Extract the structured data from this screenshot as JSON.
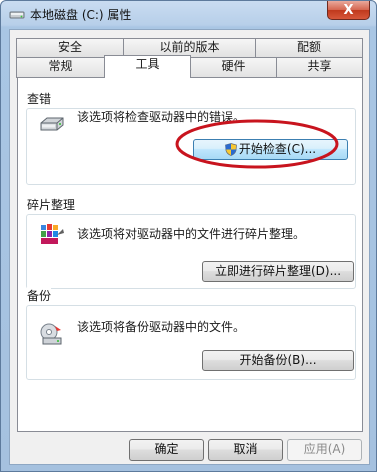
{
  "window": {
    "title": "本地磁盘 (C:) 属性",
    "close_symbol": "X"
  },
  "tabs_top": [
    {
      "label": "安全"
    },
    {
      "label": "以前的版本"
    },
    {
      "label": "配额"
    }
  ],
  "tabs_bottom": [
    {
      "label": "常规"
    },
    {
      "label": "工具",
      "active": true
    },
    {
      "label": "硬件"
    },
    {
      "label": "共享"
    }
  ],
  "sections": {
    "check": {
      "title": "查错",
      "description": "该选项将检查驱动器中的错误。",
      "button": "开始检查(C)...",
      "icon": "drive-icon"
    },
    "defrag": {
      "title": "碎片整理",
      "description": "该选项将对驱动器中的文件进行碎片整理。",
      "button": "立即进行碎片整理(D)...",
      "icon": "defrag-icon"
    },
    "backup": {
      "title": "备份",
      "description": "该选项将备份驱动器中的文件。",
      "button": "开始备份(B)...",
      "icon": "backup-icon"
    }
  },
  "footer": {
    "ok": "确定",
    "cancel": "取消",
    "apply": "应用(A)"
  },
  "colors": {
    "annotation_red": "#c8141e",
    "focus_blue": "#3c7fb1",
    "titlebar": "#b7cfe9"
  }
}
